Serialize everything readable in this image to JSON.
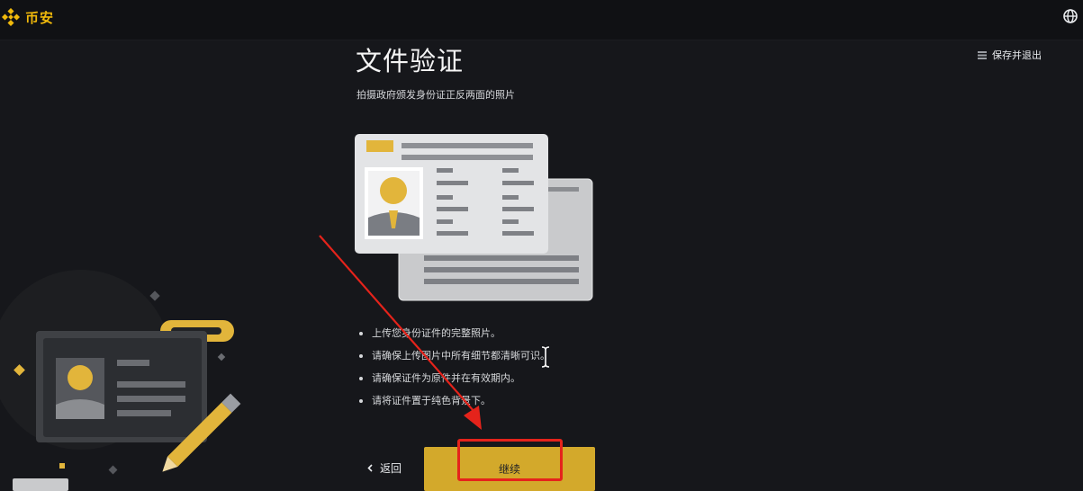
{
  "header": {
    "brand_name": "币安"
  },
  "main": {
    "title": "文件验证",
    "subtitle": "拍摄政府颁发身份证正反两面的照片",
    "save_exit_label": "保存并退出",
    "tips": [
      "上传您身份证件的完整照片。",
      "请确保上传图片中所有细节都清晰可识。",
      "请确保证件为原件并在有效期内。",
      "请将证件置于纯色背景下。"
    ],
    "back_label": "返回",
    "continue_label": "继续"
  },
  "colors": {
    "accent": "#f0b90b",
    "button": "#d3a92b",
    "background": "#16171b",
    "annotation": "#e5231b"
  },
  "icons": [
    "binance-logo-icon",
    "globe-icon",
    "menu-icon",
    "chevron-left-icon",
    "text-cursor-icon"
  ]
}
